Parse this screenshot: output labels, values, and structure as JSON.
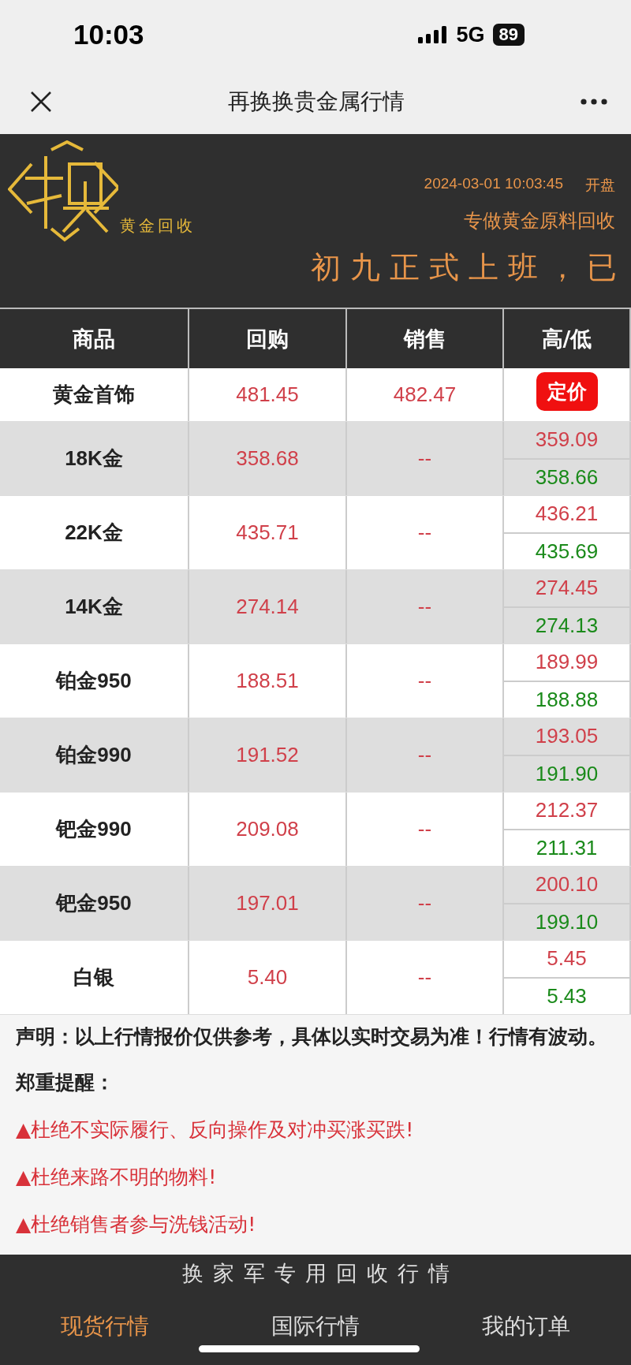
{
  "status_bar": {
    "time": "10:03",
    "network": "5G",
    "battery": "89"
  },
  "nav": {
    "title": "再换换贵金属行情"
  },
  "header": {
    "logo_text": "黄金回收",
    "datetime": "2024-03-01 10:03:45",
    "market_state": "开盘",
    "slogan": "专做黄金原料回收",
    "marquee": "初九正式上班，已"
  },
  "table": {
    "columns": [
      "商品",
      "回购",
      "销售",
      "高/低"
    ],
    "rows": [
      {
        "kind": "badge",
        "name": "黄金首饰",
        "buy": "481.45",
        "sell": "482.47",
        "badge": "定价"
      },
      {
        "kind": "range",
        "name": "18K金",
        "buy": "358.68",
        "sell": "--",
        "high": "359.09",
        "low": "358.66"
      },
      {
        "kind": "range",
        "name": "22K金",
        "buy": "435.71",
        "sell": "--",
        "high": "436.21",
        "low": "435.69"
      },
      {
        "kind": "range",
        "name": "14K金",
        "buy": "274.14",
        "sell": "--",
        "high": "274.45",
        "low": "274.13"
      },
      {
        "kind": "range",
        "name": "铂金950",
        "buy": "188.51",
        "sell": "--",
        "high": "189.99",
        "low": "188.88"
      },
      {
        "kind": "range",
        "name": "铂金990",
        "buy": "191.52",
        "sell": "--",
        "high": "193.05",
        "low": "191.90"
      },
      {
        "kind": "range",
        "name": "钯金990",
        "buy": "209.08",
        "sell": "--",
        "high": "212.37",
        "low": "211.31"
      },
      {
        "kind": "range",
        "name": "钯金950",
        "buy": "197.01",
        "sell": "--",
        "high": "200.10",
        "low": "199.10"
      },
      {
        "kind": "range",
        "name": "白银",
        "buy": "5.40",
        "sell": "--",
        "high": "5.45",
        "low": "5.43"
      }
    ]
  },
  "notice": {
    "statement": "声明：以上行情报价仅供参考，具体以实时交易为准！行情有波动。",
    "reminder_title": "郑重提醒：",
    "warnings": [
      "▲杜绝不实际履行、反向操作及对冲买涨买跌!",
      "▲杜绝来路不明的物料!",
      "▲杜绝销售者参与洗钱活动!"
    ]
  },
  "footer": {
    "caption": "换家军专用回收行情",
    "tabs": [
      {
        "label": "现货行情",
        "selected": true
      },
      {
        "label": "国际行情",
        "selected": false
      },
      {
        "label": "我的订单",
        "selected": false
      }
    ]
  }
}
